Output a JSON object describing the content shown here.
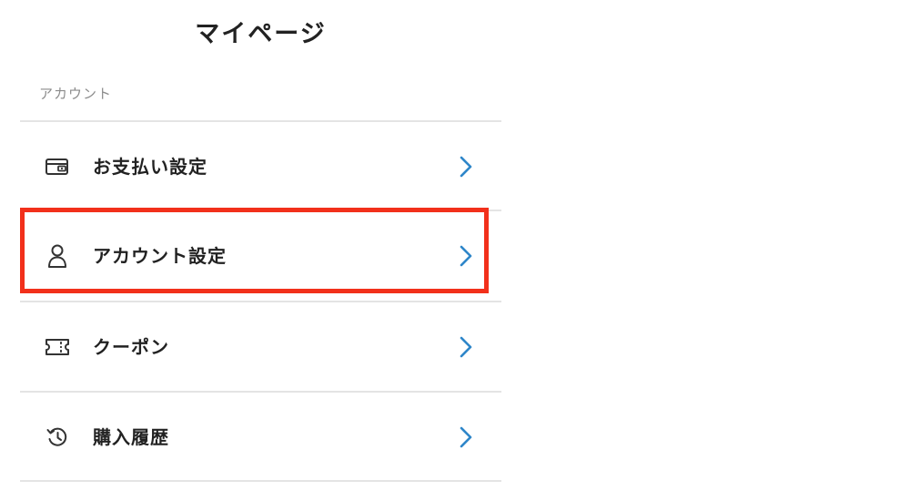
{
  "header": {
    "title": "マイページ"
  },
  "section": {
    "label": "アカウント"
  },
  "menu": {
    "items": [
      {
        "label": "お支払い設定",
        "icon": "wallet-icon"
      },
      {
        "label": "アカウント設定",
        "icon": "user-icon",
        "highlighted": true
      },
      {
        "label": "クーポン",
        "icon": "ticket-icon"
      },
      {
        "label": "購入履歴",
        "icon": "history-icon"
      }
    ]
  },
  "colors": {
    "chevron": "#2e86c9",
    "highlight": "#f2301b",
    "divider": "#e4e4e4",
    "section_label": "#8c8c8c"
  }
}
